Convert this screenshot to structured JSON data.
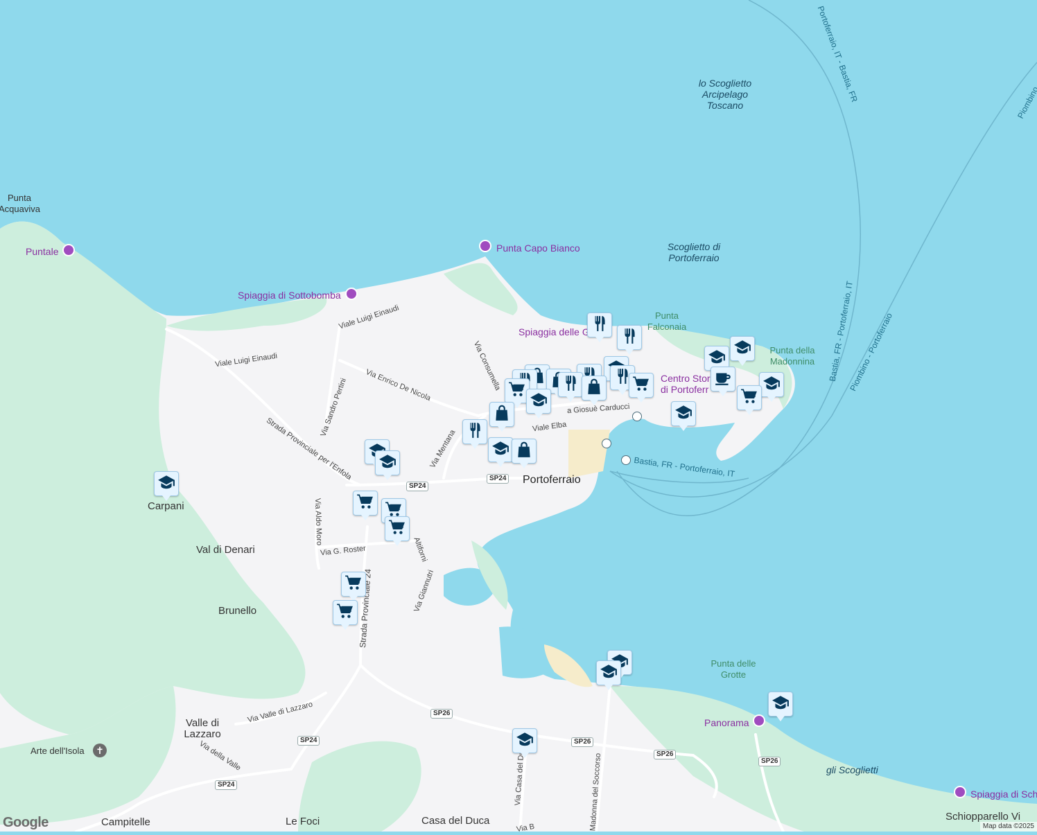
{
  "colors": {
    "water": "#8fd9ec",
    "land": "#f4f4f6",
    "green": "#cdeedd",
    "marker": "#073a5c"
  },
  "labels": {
    "punta_acquaviva": "Punta\nAcquaviva",
    "puntale": "Puntale",
    "punta_capo_bianco": "Punta Capo Bianco",
    "spiaggia_sottobomba": "Spiaggia di Sottobomba",
    "scoglietto_arcipelago": "lo Scoglietto\nArcipelago\nToscano",
    "scoglietto_portoferraio": "Scoglietto di\nPortoferraio",
    "punta_falconaia": "Punta\nFalconaia",
    "spiaggia_ghiaie": "Spiaggia delle G",
    "punta_madonnina": "Punta della\nMadonnina",
    "centro_storico": "Centro Stori\ndi Portoferr",
    "portoferraio": "Portoferraio",
    "carpani": "Carpani",
    "val_di_denari": "Val di Denari",
    "brunello": "Brunello",
    "valle_di_lazzaro": "Valle di\nLazzaro",
    "arte_isola": "Arte dell'Isola",
    "campitelle": "Campitelle",
    "le_foci": "Le Foci",
    "casa_del_duca": "Casa del Duca",
    "punta_grotte": "Punta delle\nGrotte",
    "panorama": "Panorama",
    "gli_scoglietti": "gli Scoglietti",
    "spiaggia_sch": "Spiaggia di Sch",
    "schiopparello": "Schiopparello Vi"
  },
  "streets": {
    "viale_luigi_einaudi_1": "Viale Luigi Einaudi",
    "viale_luigi_einaudi_2": "Viale Luigi Einaudi",
    "via_enrico_de_nicola": "Via Enrico De Nicola",
    "via_sandro_pertini": "Via Sandro Pertini",
    "strada_prov_enfola": "Strada Provinciale per l'Enfola",
    "via_consumella": "Via Consumella",
    "via_mentana": "Via Mentana",
    "viale_elba": "Viale Elba",
    "via_carducci": "a Giosuè Carducci",
    "via_aldo_moro": "Via Aldo Moro",
    "via_g_roster": "Via G. Roster",
    "via_altiforni": "Altiforni",
    "via_giannutri": "Via Giannutri",
    "strada_prov_24": "Strada Provinciale 24",
    "via_valle_lazzaro": "Via Valle di Lazzaro",
    "via_della_valle": "Via della Valle",
    "via_casa_del_duca": "Via Casa del Du",
    "via_madonna_soccorso": "Madonna del Soccorso",
    "via_b": "Via B"
  },
  "routes": {
    "portoferraio_bastia": "Portoferraio, IT - Bastia, FR",
    "piombino_1": "Piombino",
    "bastia_portoferraio_1": "Bastia, FR - Portoferraio, IT",
    "piombino_portoferraio": "Piombino - Portoferraio",
    "bastia_portoferraio_2": "Bastia, FR - Portoferraio, IT"
  },
  "shields": {
    "sp24": "SP24",
    "sp26": "SP26"
  },
  "markers": [
    {
      "icon": "restaurant-icon"
    },
    {
      "icon": "restaurant-icon"
    },
    {
      "icon": "school-icon"
    },
    {
      "icon": "school-icon"
    },
    {
      "icon": "school-icon"
    },
    {
      "icon": "cafe-icon"
    },
    {
      "icon": "shopping-cart-icon"
    },
    {
      "icon": "school-icon"
    },
    {
      "icon": "school-icon"
    },
    {
      "icon": "restaurant-icon"
    },
    {
      "icon": "restaurant-icon"
    },
    {
      "icon": "shopping-bag-icon"
    },
    {
      "icon": "shopping-cart-icon"
    },
    {
      "icon": "restaurant-icon"
    },
    {
      "icon": "shopping-bag-icon"
    },
    {
      "icon": "restaurant-icon"
    },
    {
      "icon": "shopping-bag-icon"
    },
    {
      "icon": "shopping-cart-icon"
    },
    {
      "icon": "school-icon"
    },
    {
      "icon": "shopping-bag-icon"
    },
    {
      "icon": "restaurant-icon"
    },
    {
      "icon": "school-icon"
    },
    {
      "icon": "shopping-bag-icon"
    },
    {
      "icon": "school-icon"
    },
    {
      "icon": "school-icon"
    },
    {
      "icon": "shopping-cart-icon"
    },
    {
      "icon": "shopping-cart-icon"
    },
    {
      "icon": "shopping-cart-icon"
    },
    {
      "icon": "shopping-cart-icon"
    },
    {
      "icon": "shopping-cart-icon"
    },
    {
      "icon": "school-icon"
    },
    {
      "icon": "school-icon"
    },
    {
      "icon": "school-icon"
    },
    {
      "icon": "school-icon"
    },
    {
      "icon": "shopping-cart-icon"
    }
  ],
  "logo": "Google",
  "attribution": "Map data ©2025"
}
